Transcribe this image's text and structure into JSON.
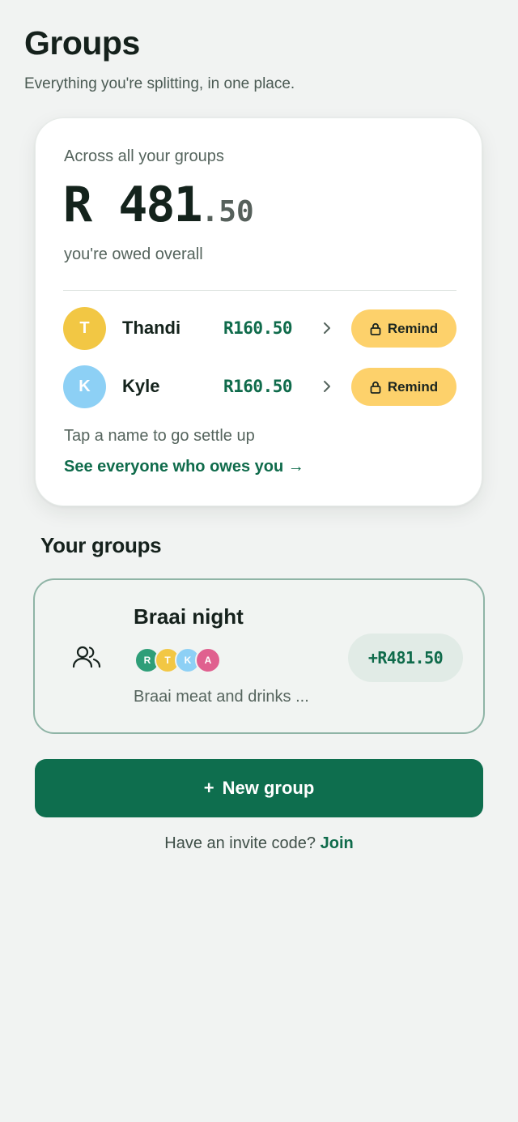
{
  "header": {
    "title": "Groups",
    "subtitle": "Everything you're splitting, in one place."
  },
  "summary": {
    "label": "Across all your groups",
    "currency": "R",
    "amount_main": "481",
    "amount_cents": ".50",
    "owed_label": "you're owed overall",
    "debtors": [
      {
        "initial": "T",
        "name": "Thandi",
        "amount": "R160.50",
        "avatar_color": "#f2c744",
        "remind_label": "Remind"
      },
      {
        "initial": "K",
        "name": "Kyle",
        "amount": "R160.50",
        "avatar_color": "#8dd0f5",
        "remind_label": "Remind"
      }
    ],
    "hint": "Tap a name to go settle up",
    "see_all": "See everyone who owes you →"
  },
  "groups_section": {
    "title": "Your groups",
    "groups": [
      {
        "name": "Braai night",
        "description": "Braai meat and drinks ...",
        "balance": "+R481.50",
        "icon": "users-icon",
        "members": [
          {
            "initial": "R",
            "color": "#2e9e78"
          },
          {
            "initial": "T",
            "color": "#f2c744"
          },
          {
            "initial": "K",
            "color": "#8dd0f5"
          },
          {
            "initial": "A",
            "color": "#e0608f"
          }
        ]
      }
    ]
  },
  "actions": {
    "new_group_label": "New group",
    "new_group_icon": "+",
    "invite_text": "Have an invite code?",
    "join_label": "Join"
  },
  "colors": {
    "accent": "#0e6e4e",
    "remind_bg": "#fdd16b",
    "background": "#f1f3f2"
  }
}
